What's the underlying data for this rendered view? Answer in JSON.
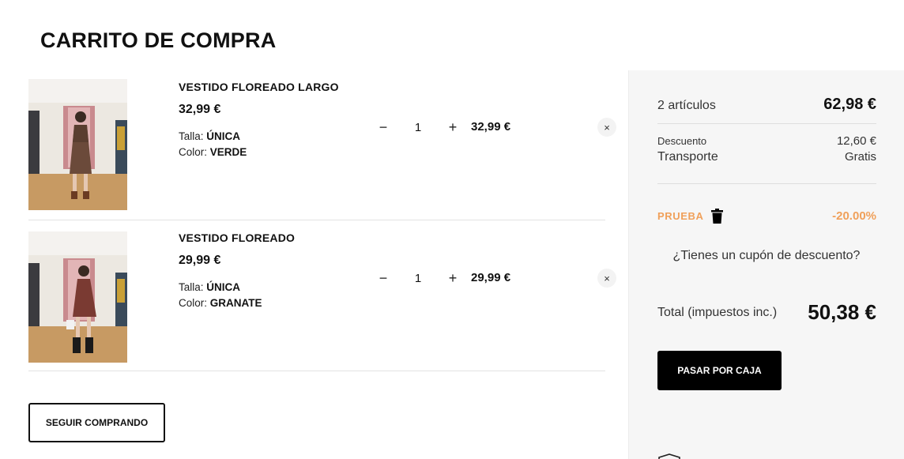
{
  "page": {
    "title": "CARRITO DE COMPRA"
  },
  "cart": {
    "items": [
      {
        "name": "VESTIDO FLOREADO LARGO",
        "price": "32,99 €",
        "size_label": "Talla:",
        "size_value": "ÚNICA",
        "color_label": "Color:",
        "color_value": "VERDE",
        "quantity": "1",
        "line_total": "32,99 €",
        "image_icon": "product-photo"
      },
      {
        "name": "VESTIDO FLOREADO",
        "price": "29,99 €",
        "size_label": "Talla:",
        "size_value": "ÚNICA",
        "color_label": "Color:",
        "color_value": "GRANATE",
        "quantity": "1",
        "line_total": "29,99 €",
        "image_icon": "product-photo"
      }
    ],
    "qty_minus": "−",
    "qty_plus": "+",
    "remove": "×",
    "continue_label": "SEGUIR COMPRANDO"
  },
  "summary": {
    "items_count": "2 artículos",
    "items_total": "62,98 €",
    "discount_label": "Descuento",
    "discount_value": "12,60 €",
    "shipping_label": "Transporte",
    "shipping_value": "Gratis",
    "promo_code": "PRUEBA",
    "promo_value": "-20.00%",
    "coupon_prompt": "¿Tienes un cupón de descuento?",
    "total_label": "Total (impuestos inc.)",
    "total_value": "50,38 €",
    "checkout_label": "PASAR POR CAJA"
  },
  "colors": {
    "accent": "#f0a05a",
    "primary": "#000000",
    "panel": "#f6f6f6"
  }
}
